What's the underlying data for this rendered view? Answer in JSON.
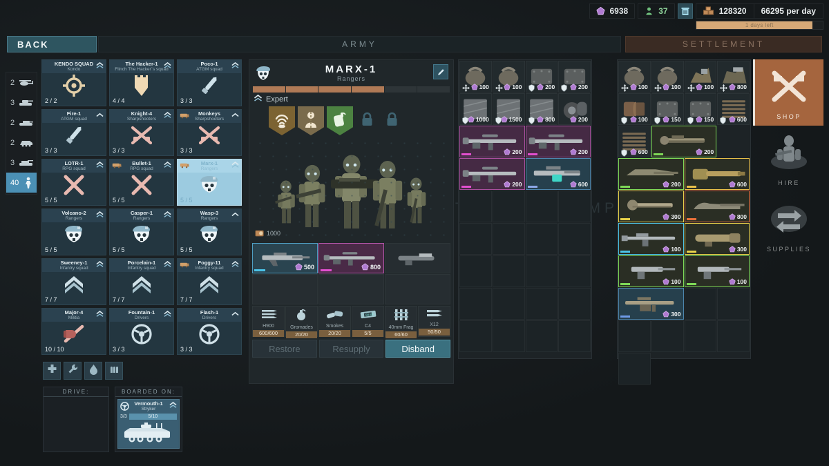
{
  "topbar": {
    "gems": "6938",
    "people": "37",
    "money": "128320",
    "per_day": "66295 per day",
    "days_left": "1 days left",
    "icons": {
      "gem": "gem-icon",
      "person": "person-icon",
      "trash": "trash-icon",
      "crate": "crate-icon"
    }
  },
  "nav": {
    "back": "BACK",
    "army": "ARMY",
    "settlement": "SETTLEMENT"
  },
  "watermark": "SETTLEMENT CAMP",
  "rail": [
    {
      "count": "2",
      "icon": "helicopter-icon",
      "selected": false
    },
    {
      "count": "3",
      "icon": "tank-icon",
      "selected": false
    },
    {
      "count": "2",
      "icon": "tank-light-icon",
      "selected": false
    },
    {
      "count": "2",
      "icon": "apc-icon",
      "selected": false
    },
    {
      "count": "3",
      "icon": "ifv-icon",
      "selected": false
    },
    {
      "count": "40",
      "icon": "infantry-icon",
      "selected": true
    }
  ],
  "squads": [
    {
      "name": "KENDO SQUAD",
      "type": "Kondo",
      "count": "2 / 2",
      "emblem": "crosshair-emblem",
      "rank": "double-chevron",
      "truck": false,
      "selected": false
    },
    {
      "name": "The Hacker-1",
      "type": "Flinch The Hacker`s squad",
      "count": "4 / 4",
      "emblem": "shield-emblem",
      "rank": "double-chevron",
      "truck": false,
      "selected": false
    },
    {
      "name": "Poco-1",
      "type": "ATGM squad",
      "count": "3 / 3",
      "emblem": "missile-emblem",
      "rank": "double-chevron",
      "truck": false,
      "selected": false
    },
    {
      "name": "Fire-1",
      "type": "ATGM squad",
      "count": "3 / 3",
      "emblem": "missile-emblem",
      "rank": "single-chevron",
      "truck": false,
      "selected": false
    },
    {
      "name": "Knight-4",
      "type": "Sharpshooters",
      "count": "3 / 3",
      "emblem": "crossed-rifles-emblem",
      "rank": "double-chevron",
      "truck": false,
      "selected": false
    },
    {
      "name": "Monkeys",
      "type": "Sharpshooters",
      "count": "3 / 3",
      "emblem": "crossed-rifles-emblem",
      "rank": "single-chevron",
      "truck": true,
      "selected": false
    },
    {
      "name": "LOTR-1",
      "type": "RPG squad",
      "count": "5 / 5",
      "emblem": "crossed-rpg-emblem",
      "rank": "double-chevron",
      "truck": false,
      "selected": false
    },
    {
      "name": "Bullet-1",
      "type": "RPG squad",
      "count": "5 / 5",
      "emblem": "crossed-rpg-emblem",
      "rank": "double-chevron",
      "truck": true,
      "selected": false
    },
    {
      "name": "Marx-1",
      "type": "Rangers",
      "count": "5 / 5",
      "emblem": "skull-beret-emblem",
      "rank": "double-chevron",
      "truck": true,
      "selected": true
    },
    {
      "name": "Volcano-2",
      "type": "Rangers",
      "count": "5 / 5",
      "emblem": "skull-beret-emblem",
      "rank": "double-chevron",
      "truck": false,
      "selected": false
    },
    {
      "name": "Casper-1",
      "type": "Rangers",
      "count": "5 / 5",
      "emblem": "skull-beret-emblem",
      "rank": "double-chevron",
      "truck": false,
      "selected": false
    },
    {
      "name": "Wasp-3",
      "type": "Rangers",
      "count": "5 / 5",
      "emblem": "skull-beret-emblem",
      "rank": "single-chevron",
      "truck": false,
      "selected": false
    },
    {
      "name": "Sweeney-1",
      "type": "Infantry squad",
      "count": "7 / 7",
      "emblem": "chevrons-emblem",
      "rank": "double-chevron",
      "truck": false,
      "selected": false
    },
    {
      "name": "Porcelain-1",
      "type": "Infantry squad",
      "count": "7 / 7",
      "emblem": "chevrons-emblem",
      "rank": "double-chevron",
      "truck": false,
      "selected": false
    },
    {
      "name": "Foggy-11",
      "type": "Infantry squad",
      "count": "7 / 7",
      "emblem": "chevrons-emblem",
      "rank": "double-chevron",
      "truck": true,
      "selected": false
    },
    {
      "name": "Major-4",
      "type": "Militia",
      "count": "10 / 10",
      "emblem": "fist-rifle-emblem",
      "rank": "double-chevron",
      "truck": false,
      "selected": false
    },
    {
      "name": "Fountain-1",
      "type": "Drivers",
      "count": "3 / 3",
      "emblem": "steering-wheel-emblem",
      "rank": "double-chevron",
      "truck": false,
      "selected": false
    },
    {
      "name": "Flash-1",
      "type": "Drivers",
      "count": "3 / 3",
      "emblem": "steering-wheel-emblem",
      "rank": "single-chevron",
      "truck": false,
      "selected": false
    }
  ],
  "actions": [
    {
      "icon": "medkit-icon",
      "name": "heal-button"
    },
    {
      "icon": "wrench-icon",
      "name": "repair-button"
    },
    {
      "icon": "fuel-drop-icon",
      "name": "fuel-button"
    },
    {
      "icon": "ammo-icon",
      "name": "ammo-button"
    }
  ],
  "drive": {
    "header": "DRIVE:"
  },
  "boarded": {
    "header": "BOARDED ON:",
    "vehicle": {
      "name": "Vermouth-1",
      "type": "Stryker",
      "crew": "3/3",
      "capacity": "5/10",
      "icon": "apc-icon",
      "rank": "double-chevron"
    }
  },
  "detail": {
    "title": "MARX-1",
    "subtitle": "Rangers",
    "emblem": "skull-beret-emblem",
    "edit_icon": "pencil-icon",
    "rank_label": "Expert",
    "rank_icon": "double-chevron",
    "xp_segments": 6,
    "xp_filled": 4,
    "perks": [
      {
        "icon": "mine-detect-icon",
        "locked": false,
        "color": "#7c6332"
      },
      {
        "icon": "camouflage-icon",
        "locked": false,
        "color": "#7a6b4c"
      },
      {
        "icon": "grenade-perk-icon",
        "locked": false,
        "color": "#4c8241"
      },
      {
        "icon": "lock-icon",
        "locked": true,
        "color": ""
      },
      {
        "icon": "lock-icon",
        "locked": true,
        "color": ""
      }
    ],
    "cargo": "1000",
    "cargo_icon": "crate-icon",
    "weapons": [
      {
        "price": "500",
        "rarity": "#4bc3e8",
        "border": "blue",
        "icon": "rifle-icon"
      },
      {
        "price": "800",
        "rarity": "#e34fd0",
        "border": "purple",
        "icon": "sniper-icon"
      },
      {
        "price": "",
        "rarity": "",
        "border": "",
        "icon": "grenade-launcher-icon"
      },
      {
        "price": "",
        "rarity": "",
        "border": "",
        "icon": ""
      },
      {
        "price": "",
        "rarity": "",
        "border": "",
        "icon": ""
      },
      {
        "price": "",
        "rarity": "",
        "border": "",
        "icon": ""
      }
    ],
    "consumables": [
      {
        "icon": "bullets-icon",
        "name": "H900",
        "value": "600/600"
      },
      {
        "icon": "grenade-icon",
        "name": "Gromades",
        "value": "20/20"
      },
      {
        "icon": "smoke-icon",
        "name": "Smokes",
        "value": "20/20"
      },
      {
        "icon": "c4-icon",
        "name": "C4",
        "value": "5/5"
      },
      {
        "icon": "frag40-icon",
        "name": "40mm Frag",
        "value": "60/60"
      },
      {
        "icon": "x12-icon",
        "name": "X12",
        "value": "50/50"
      }
    ],
    "buttons": [
      {
        "label": "Restore",
        "state": "disabled"
      },
      {
        "label": "Resupply",
        "state": "disabled"
      },
      {
        "label": "Disband",
        "state": "active"
      }
    ]
  },
  "stash": [
    {
      "icon": "backpack-icon",
      "price": "100",
      "badge": "move-icon",
      "border": "none",
      "rarity": ""
    },
    {
      "icon": "backpack-icon",
      "price": "100",
      "badge": "move-icon",
      "border": "none",
      "rarity": ""
    },
    {
      "icon": "armor-plate-icon",
      "price": "200",
      "badge": "shield-icon",
      "border": "none",
      "rarity": ""
    },
    {
      "icon": "armor-plate-icon",
      "price": "200",
      "badge": "shield-icon",
      "border": "none",
      "rarity": ""
    },
    {
      "icon": "armor-heavy-icon",
      "price": "1000",
      "badge": "shield-icon",
      "border": "none",
      "rarity": ""
    },
    {
      "icon": "armor-heavy-icon",
      "price": "1500",
      "badge": "shield-icon",
      "border": "none",
      "rarity": ""
    },
    {
      "icon": "armor-heavy-icon",
      "price": "800",
      "badge": "shield-icon",
      "border": "none",
      "rarity": ""
    },
    {
      "icon": "tire-icon",
      "price": "200",
      "badge": "",
      "border": "none",
      "rarity": ""
    },
    {
      "icon": "sniper-icon",
      "price": "200",
      "badge": "",
      "border": "purple",
      "rarity": "#e34fd0",
      "span2": true
    },
    {
      "icon": "sniper-icon",
      "price": "200",
      "badge": "",
      "border": "purple",
      "rarity": "#e34fd0",
      "span2": true
    },
    {
      "icon": "sniper-icon",
      "price": "200",
      "badge": "",
      "border": "purple",
      "rarity": "#e34fd0",
      "span2": true
    },
    {
      "icon": "smg-scope-icon",
      "price": "600",
      "badge": "",
      "border": "blue",
      "rarity": "#8ea8e8",
      "span2": true
    }
  ],
  "shop": [
    {
      "icon": "backpack-icon",
      "price": "100",
      "badge": "move-icon",
      "border": "none",
      "rarity": ""
    },
    {
      "icon": "backpack-icon",
      "price": "100",
      "badge": "move-icon",
      "border": "none",
      "rarity": ""
    },
    {
      "icon": "scrap-icon",
      "price": "100",
      "badge": "move-icon",
      "border": "none",
      "rarity": ""
    },
    {
      "icon": "scrap-heavy-icon",
      "price": "800",
      "badge": "move-icon",
      "border": "none",
      "rarity": ""
    },
    {
      "icon": "barrel-icon",
      "price": "100",
      "badge": "shield-icon",
      "border": "none",
      "rarity": ""
    },
    {
      "icon": "armor-plate-icon",
      "price": "150",
      "badge": "shield-icon",
      "border": "none",
      "rarity": ""
    },
    {
      "icon": "armor-plate-icon",
      "price": "150",
      "badge": "shield-icon",
      "border": "none",
      "rarity": ""
    },
    {
      "icon": "slats-icon",
      "price": "600",
      "badge": "shield-icon",
      "border": "none",
      "rarity": ""
    },
    {
      "icon": "slats-icon",
      "price": "600",
      "badge": "shield-icon",
      "border": "none",
      "rarity": ""
    },
    {
      "icon": "minigun-icon",
      "price": "200",
      "badge": "",
      "border": "green",
      "rarity": "#7ed957",
      "span2": true
    },
    {
      "icon": "autocannon-icon",
      "price": "200",
      "badge": "",
      "border": "green",
      "rarity": "#7ed957",
      "span2": true
    },
    {
      "icon": "cannon-icon",
      "price": "600",
      "badge": "",
      "border": "gold",
      "rarity": "#e8c04a",
      "span2": true
    },
    {
      "icon": "gatling-icon",
      "price": "300",
      "badge": "",
      "border": "olive",
      "rarity": "#e8d24a",
      "span2": true
    },
    {
      "icon": "heavy-mg-icon",
      "price": "800",
      "badge": "",
      "border": "red",
      "rarity": "#e8703a",
      "span2": true
    },
    {
      "icon": "assault-rifle-icon",
      "price": "100",
      "badge": "",
      "border": "teal",
      "rarity": "#4bc3e8",
      "span2": true
    },
    {
      "icon": "rocket-tube-icon",
      "price": "300",
      "badge": "",
      "border": "olive",
      "rarity": "#e8d24a",
      "span2": true
    },
    {
      "icon": "smg-icon",
      "price": "100",
      "badge": "",
      "border": "green",
      "rarity": "#7ed957",
      "span2": true
    },
    {
      "icon": "smg-icon",
      "price": "100",
      "badge": "",
      "border": "green",
      "rarity": "#7ed957",
      "span2": true
    },
    {
      "icon": "lmg-scope-icon",
      "price": "300",
      "badge": "",
      "border": "blue",
      "rarity": "#6f9be8",
      "span2": true
    }
  ],
  "sidetabs": [
    {
      "label": "SHOP",
      "icon": "crossed-rifles-icon",
      "active": true
    },
    {
      "label": "HIRE",
      "icon": "soldier-icon",
      "active": false
    },
    {
      "label": "SUPPLIES",
      "icon": "exchange-arrows-icon",
      "active": false
    }
  ]
}
